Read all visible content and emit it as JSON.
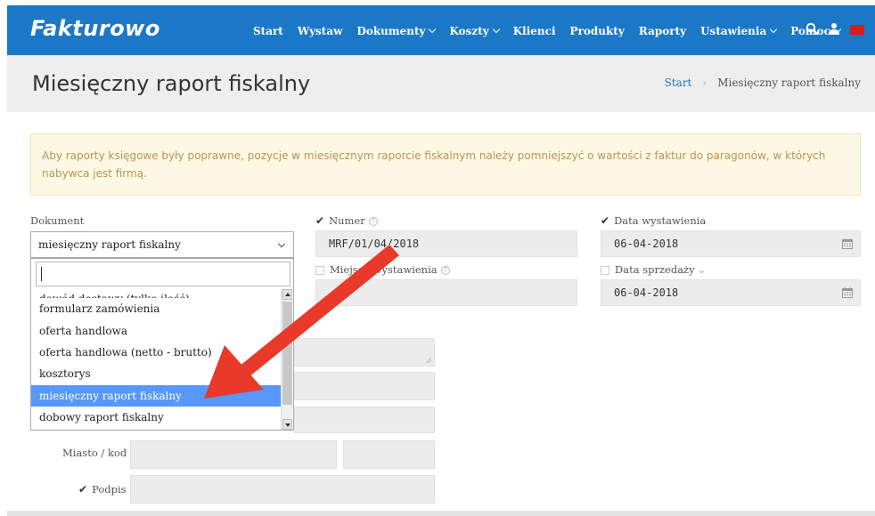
{
  "app": {
    "logo": "Fakturowo"
  },
  "nav": [
    {
      "label": "Start",
      "dropdown": false
    },
    {
      "label": "Wystaw",
      "dropdown": false
    },
    {
      "label": "Dokumenty",
      "dropdown": true
    },
    {
      "label": "Koszty",
      "dropdown": true
    },
    {
      "label": "Klienci",
      "dropdown": false
    },
    {
      "label": "Produkty",
      "dropdown": false
    },
    {
      "label": "Raporty",
      "dropdown": false
    },
    {
      "label": "Ustawienia",
      "dropdown": true
    },
    {
      "label": "Pomoc",
      "dropdown": true
    }
  ],
  "icons": {
    "search": "search-icon",
    "user": "user-icon",
    "flag": "flag-icon",
    "flag_color": "#e0191e"
  },
  "header": {
    "title": "Miesięczny raport fiskalny"
  },
  "breadcrumb": {
    "home": "Start",
    "separator": "›",
    "current": "Miesięczny raport fiskalny"
  },
  "alert": {
    "text": "Aby raporty księgowe były poprawne, pozycje w miesięcznym raporcie fiskalnym należy pomniejszyć o wartości z faktur do paragonów, w których nabywca jest firmą."
  },
  "form": {
    "dokument_label": "Dokument",
    "dokument_value": "miesięczny raport fiskalny",
    "numer_label": "Numer",
    "numer_value": "MRF/01/04/2018",
    "miejsce_label": "Miejsce wystawienia",
    "data_wyst_label": "Data wystawienia",
    "data_wyst_value": "06-04-2018",
    "data_sprz_label": "Data sprzedaży",
    "data_sprz_value": "06-04-2018",
    "miasto_label": "Miasto / kod",
    "podpis_label": "Podpis"
  },
  "dropdown": {
    "search_value": "",
    "items": [
      {
        "label": "dowód dostawy (tylko ilość)",
        "partial": true
      },
      {
        "label": "formularz zamówienia"
      },
      {
        "label": "oferta handlowa"
      },
      {
        "label": "oferta handlowa (netto - brutto)"
      },
      {
        "label": "kosztorys"
      },
      {
        "label": "miesięczny raport fiskalny",
        "selected": true
      },
      {
        "label": "dobowy raport fiskalny"
      }
    ]
  },
  "colors": {
    "brand": "#1b78c7",
    "selected": "#5897fb",
    "arrow": "#e8392a",
    "alert_bg": "#fcf8e3",
    "alert_text": "#b79559"
  }
}
